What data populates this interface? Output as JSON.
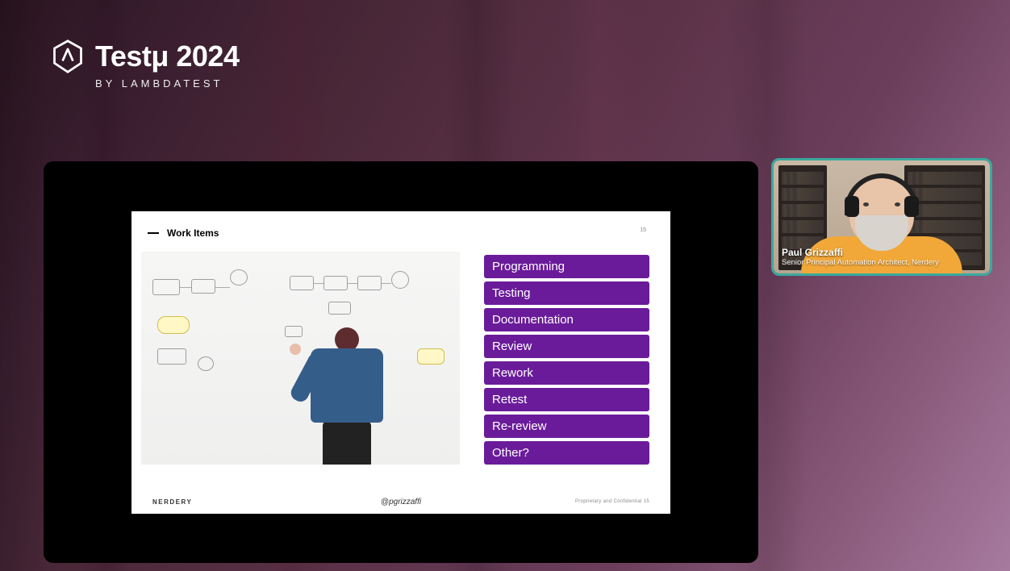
{
  "branding": {
    "event_name": "Testμ 2024",
    "byline": "BY LAMBDATEST"
  },
  "slide": {
    "title": "Work Items",
    "page_top": "15",
    "items": [
      "Programming",
      "Testing",
      "Documentation",
      "Review",
      "Rework",
      "Retest",
      "Re-review",
      "Other?"
    ],
    "footer_left": "NERDERY",
    "footer_center": "@pgrizzaffi",
    "footer_right": "Proprietary and Confidential   15"
  },
  "speaker": {
    "name": "Paul Grizzaffi",
    "role": "Senior Principal Automation Architect, Nerdery"
  }
}
